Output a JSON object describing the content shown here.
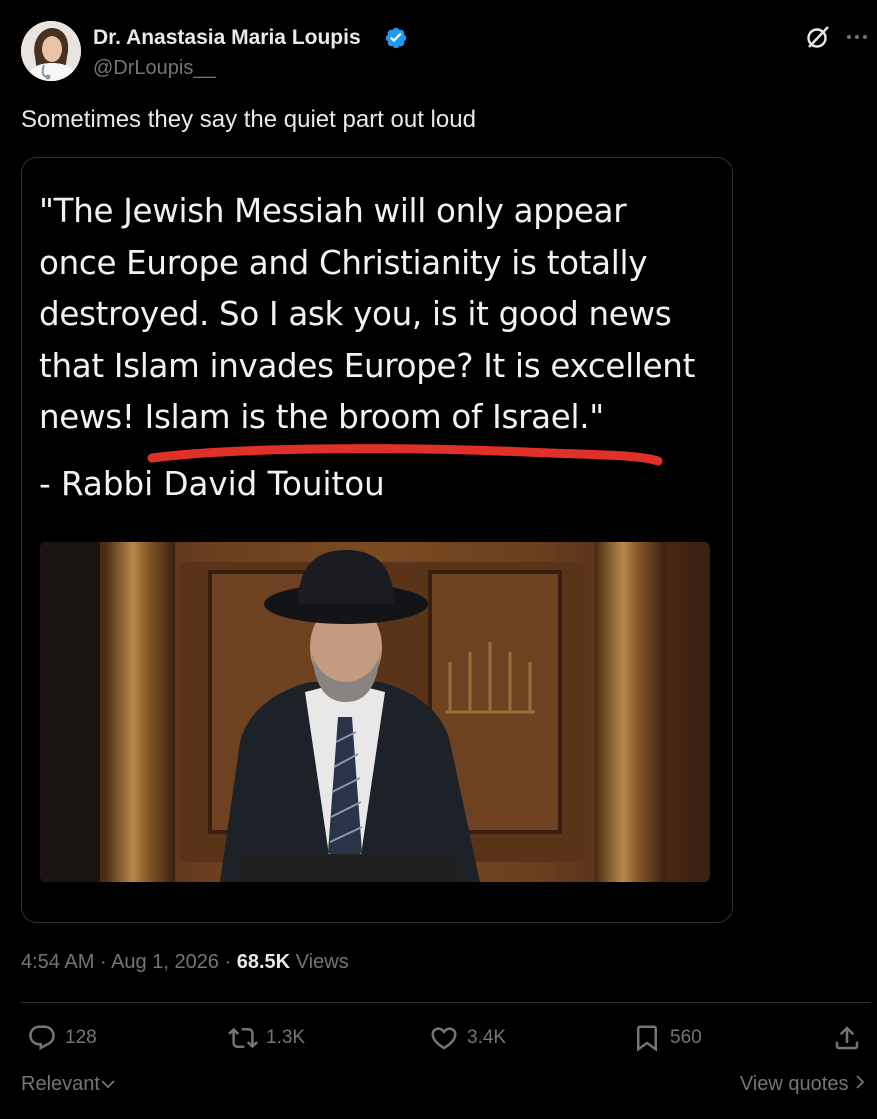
{
  "author": {
    "name": "Dr. Anastasia Maria Loupis",
    "handle": "@DrLoupis__",
    "verified": true
  },
  "header_icons": [
    "grok-icon",
    "more-icon"
  ],
  "tweet": {
    "text": "Sometimes they say the quiet part out loud"
  },
  "media": {
    "quote": "\"The Jewish Messiah will only appear\nonce Europe and Christianity is totally\ndestroyed. So I ask you, is it good news\nthat Islam invades Europe? It is excellent\nnews! Islam is the broom of Israel.\"",
    "attribution": "- Rabbi David Touitou",
    "underline_color": "#e0302a"
  },
  "meta": {
    "time": "4:54 AM",
    "sep1": " · ",
    "date": "Aug 1, 2026",
    "sep2": " · ",
    "views_count": "68.5K",
    "views_label": " Views"
  },
  "actions": {
    "replies": "128",
    "reposts": "1.3K",
    "likes": "3.4K",
    "bookmarks": "560"
  },
  "footer": {
    "sort_label": "Relevant",
    "view_quotes_label": "View quotes"
  },
  "colors": {
    "background": "#000000",
    "text": "#e7e9ea",
    "muted": "#71767b",
    "verified": "#1d9bf0",
    "border": "#2f3336"
  }
}
